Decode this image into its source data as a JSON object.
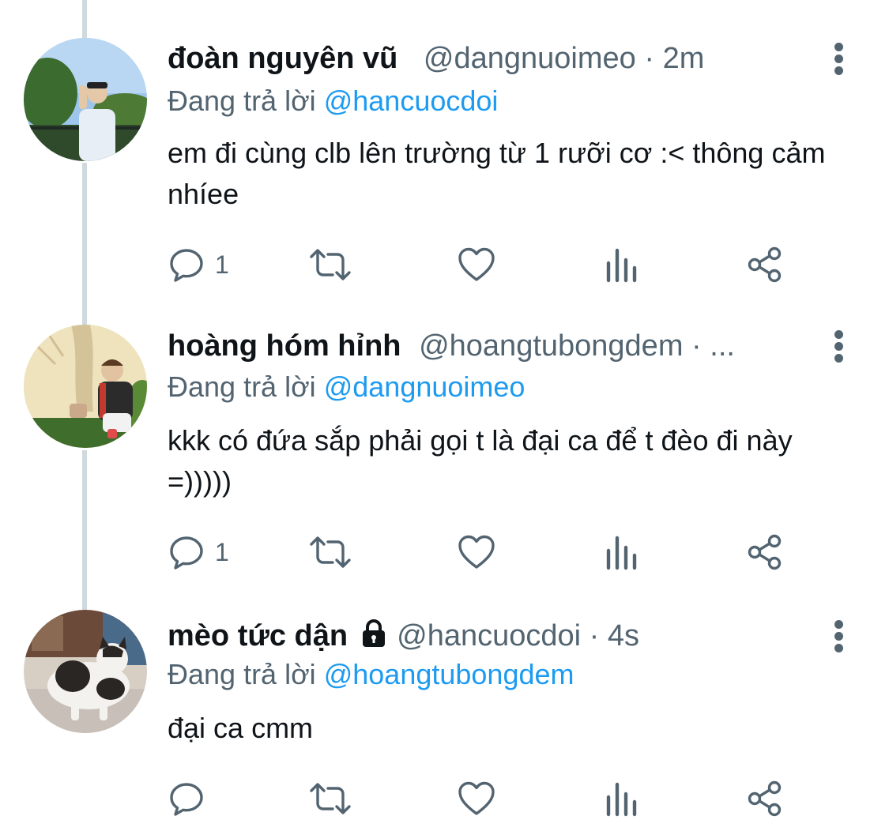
{
  "colors": {
    "text": "#0f1419",
    "secondary": "#536471",
    "link": "#1d9bf0",
    "thread_line": "#cfd9de"
  },
  "tweets": [
    {
      "display_name": "đoàn nguyên vũ",
      "handle": "@dangnuoimeo",
      "separator": "·",
      "time": "2m",
      "reply_prefix": "Đang trả lời",
      "reply_to": "@hancuocdoi",
      "text": "em đi cùng clb lên trường từ 1 rưỡi cơ :< thông cảm nhíee",
      "reply_count": "1",
      "icons": [
        "reply-icon",
        "retweet-icon",
        "like-icon",
        "analytics-icon",
        "share-icon"
      ]
    },
    {
      "display_name": "hoàng hóm hỉnh",
      "handle": "@hoangtubongdem",
      "separator": "·",
      "time": "...",
      "reply_prefix": "Đang trả lời",
      "reply_to": "@dangnuoimeo",
      "text": "kkk có đứa sắp phải gọi t là đại ca để t đèo đi này =)))))",
      "reply_count": "1",
      "icons": [
        "reply-icon",
        "retweet-icon",
        "like-icon",
        "analytics-icon",
        "share-icon"
      ]
    },
    {
      "display_name": "mèo tức dận",
      "protected_icon": "lock-icon",
      "handle": "@hancuocdoi",
      "separator": "·",
      "time": "4s",
      "reply_prefix": "Đang trả lời",
      "reply_to": "@hoangtubongdem",
      "text": "đại ca cmm",
      "reply_count": "",
      "icons": [
        "reply-icon",
        "retweet-icon",
        "like-icon",
        "analytics-icon",
        "share-icon"
      ]
    }
  ]
}
